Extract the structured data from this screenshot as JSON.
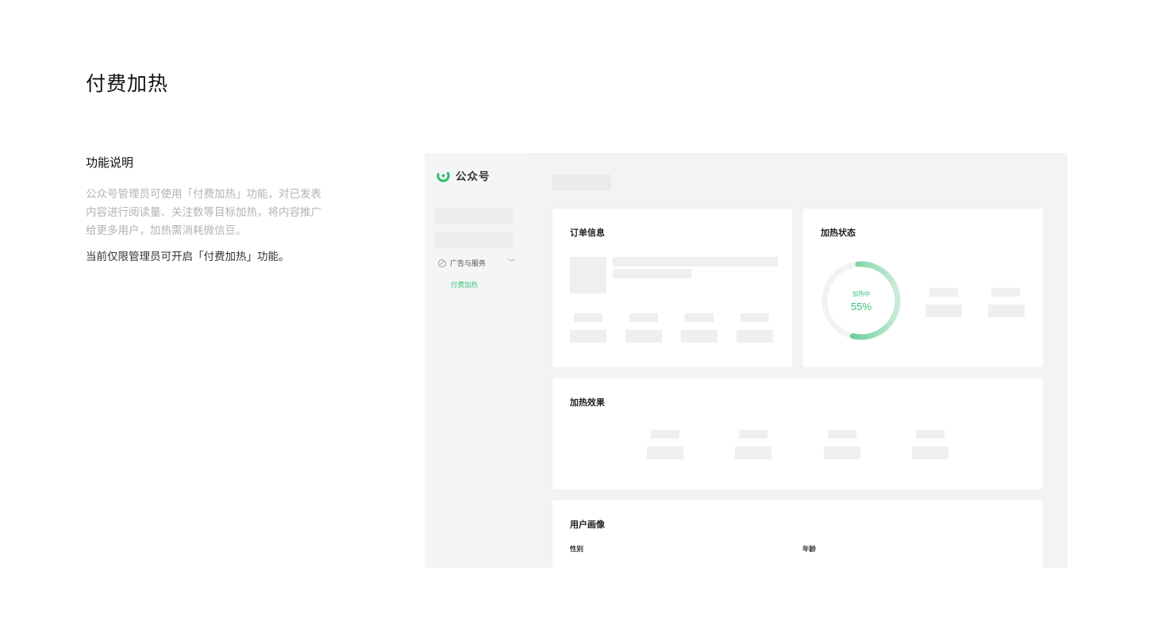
{
  "page": {
    "title": "付费加热"
  },
  "description": {
    "heading": "功能说明",
    "body": "公众号管理员可使用「付费加热」功能，对已发表内容进行阅读量、关注数等目标加热，将内容推广给更多用户，加热需消耗微信豆。",
    "note": "当前仅限管理员可开启「付费加热」功能。"
  },
  "mockup": {
    "brand": "公众号",
    "sidebar": {
      "menu_item": "广告与服务",
      "sub_item": "付费加热"
    },
    "cards": {
      "order_title": "订单信息",
      "status_title": "加热状态",
      "effect_title": "加热效果",
      "user_title": "用户画像",
      "gender_label": "性别",
      "age_label": "年龄"
    },
    "status": {
      "label": "加热中",
      "percent_text": "55%",
      "progress": 0.55
    },
    "colors": {
      "accent": "#3bbf7a",
      "background": "#f4f5f6",
      "skeleton": "#eeeff1"
    }
  }
}
